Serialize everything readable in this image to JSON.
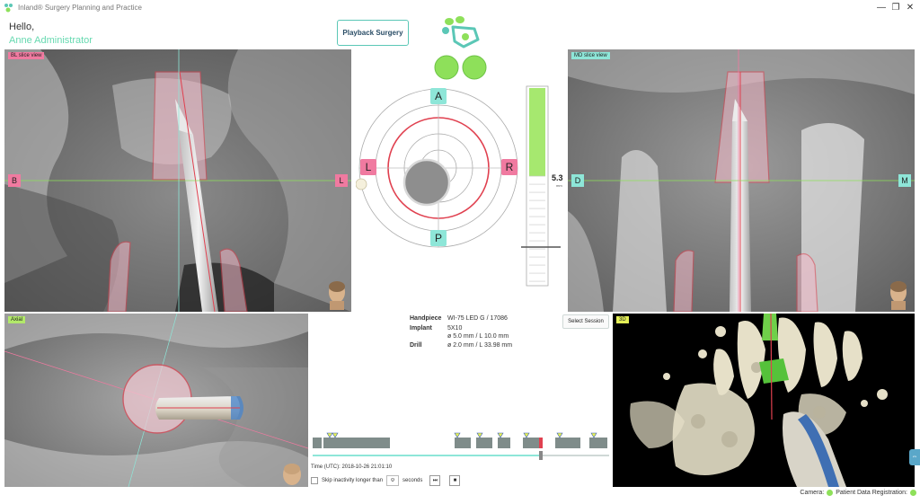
{
  "window": {
    "title": "Inland® Surgery Planning and Practice",
    "minimize": "—",
    "maximize": "❐",
    "close": "✕"
  },
  "header": {
    "greeting": "Hello,",
    "user_name": "Anne Administrator",
    "playback_label": "Playback Surgery"
  },
  "panels": {
    "bl_view": {
      "tag": "BL slice view",
      "left_marker": "B",
      "right_marker": "L"
    },
    "md_view": {
      "tag": "MD slice view",
      "left_marker": "D",
      "right_marker": "M"
    },
    "axial_view": {
      "tag": "Axial"
    },
    "view_3d": {
      "tag": "3D"
    }
  },
  "compass": {
    "top": "A",
    "left": "L",
    "right": "R",
    "bottom": "P"
  },
  "depth": {
    "value": "5.3",
    "unit": "mm",
    "fill_fraction": 0.45
  },
  "info": {
    "handpiece_label": "Handpiece",
    "handpiece_value": "WI-75 LED G / 17086",
    "implant_label": "Implant",
    "implant_model": "5X10",
    "implant_dims": "ø 5.0 mm / L 10.0 mm",
    "drill_label": "Drill",
    "drill_dims": "ø 2.0 mm / L 33.98 mm"
  },
  "session": {
    "select_label": "Select Session"
  },
  "timeline": {
    "time_text": "Time (UTC): 2018-10-26 21:01:10",
    "skip_label": "Skip inactivity longer than",
    "skip_value": "0",
    "skip_unit": "seconds",
    "btn_skip": "⏭",
    "btn_stop": "■"
  },
  "status": {
    "camera_label": "Camera:",
    "registration_label": "Patient Data Registration:"
  },
  "colors": {
    "accent": "#5bc7b6",
    "plan_red": "#e0404f",
    "indicator_green": "#8ee05a"
  }
}
